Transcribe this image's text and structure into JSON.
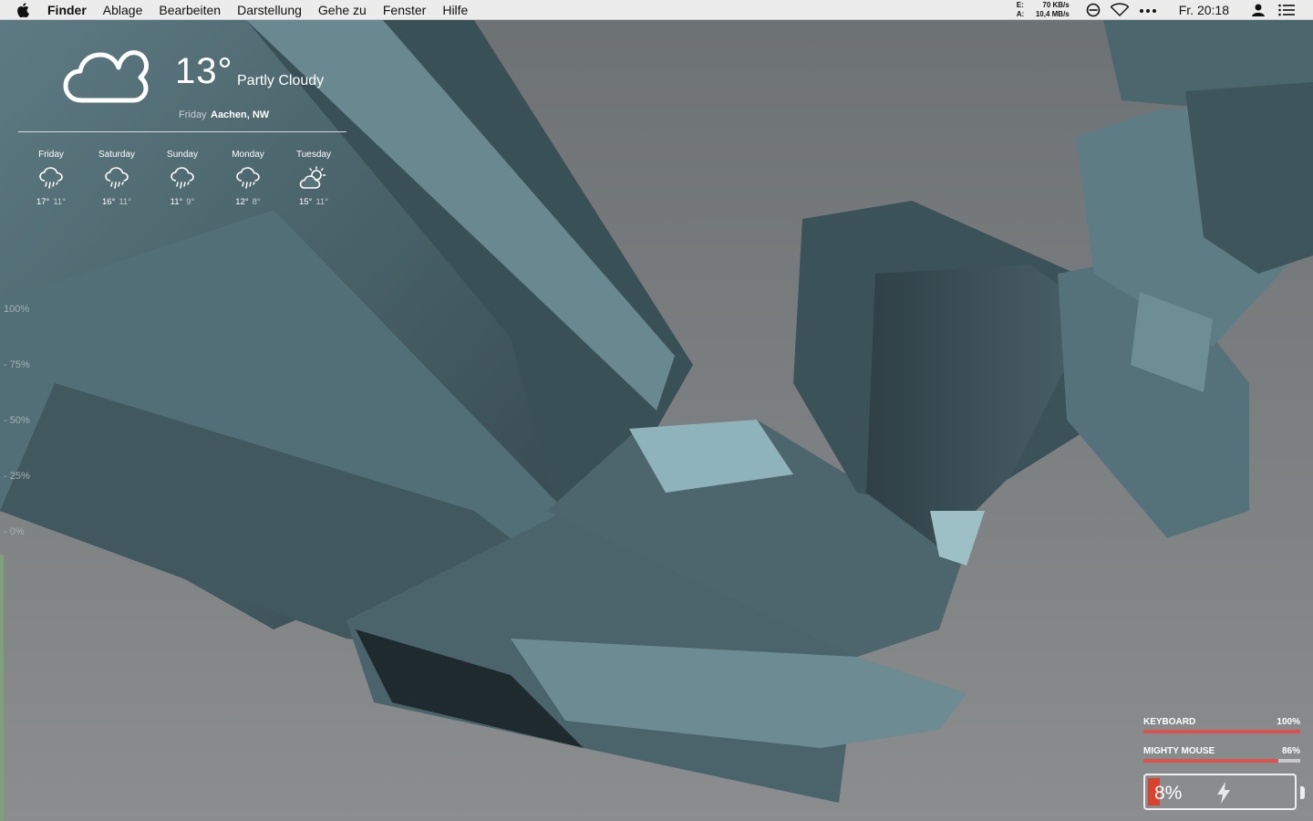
{
  "menubar": {
    "app": "Finder",
    "items": [
      "Ablage",
      "Bearbeiten",
      "Darstellung",
      "Gehe zu",
      "Fenster",
      "Hilfe"
    ],
    "net": {
      "in_label": "E:",
      "in_value": "70 KB/s",
      "out_label": "A:",
      "out_value": "10,4 MB/s"
    },
    "clock": "Fr. 20:18"
  },
  "weather": {
    "temp": "13°",
    "condition": "Partly Cloudy",
    "day": "Friday",
    "location": "Aachen, NW",
    "forecast": [
      {
        "day": "Friday",
        "icon": "rain-icon",
        "high": "17°",
        "low": "11°"
      },
      {
        "day": "Saturday",
        "icon": "rain-icon",
        "high": "16°",
        "low": "11°"
      },
      {
        "day": "Sunday",
        "icon": "rain-icon",
        "high": "11°",
        "low": "9°"
      },
      {
        "day": "Monday",
        "icon": "rain-icon",
        "high": "12°",
        "low": "8°"
      },
      {
        "day": "Tuesday",
        "icon": "partly-sunny-icon",
        "high": "15°",
        "low": "11°"
      }
    ]
  },
  "gauge": {
    "labels": [
      "100%",
      "- 75%",
      "- 50%",
      "- 25%",
      "- 0%"
    ]
  },
  "battery": {
    "devices": [
      {
        "name": "KEYBOARD",
        "percent_text": "100%",
        "level": 1.0
      },
      {
        "name": "MIGHTY MOUSE",
        "percent_text": "86%",
        "level": 0.86
      }
    ],
    "mac_percent_text": "8%",
    "mac_level": 0.08,
    "charging": true
  },
  "colors": {
    "wallpaper_bg": "#7b7e80",
    "crystal": "#4f6a72",
    "battery_low": "#d9432e",
    "bar_fill": "#d9534f"
  }
}
